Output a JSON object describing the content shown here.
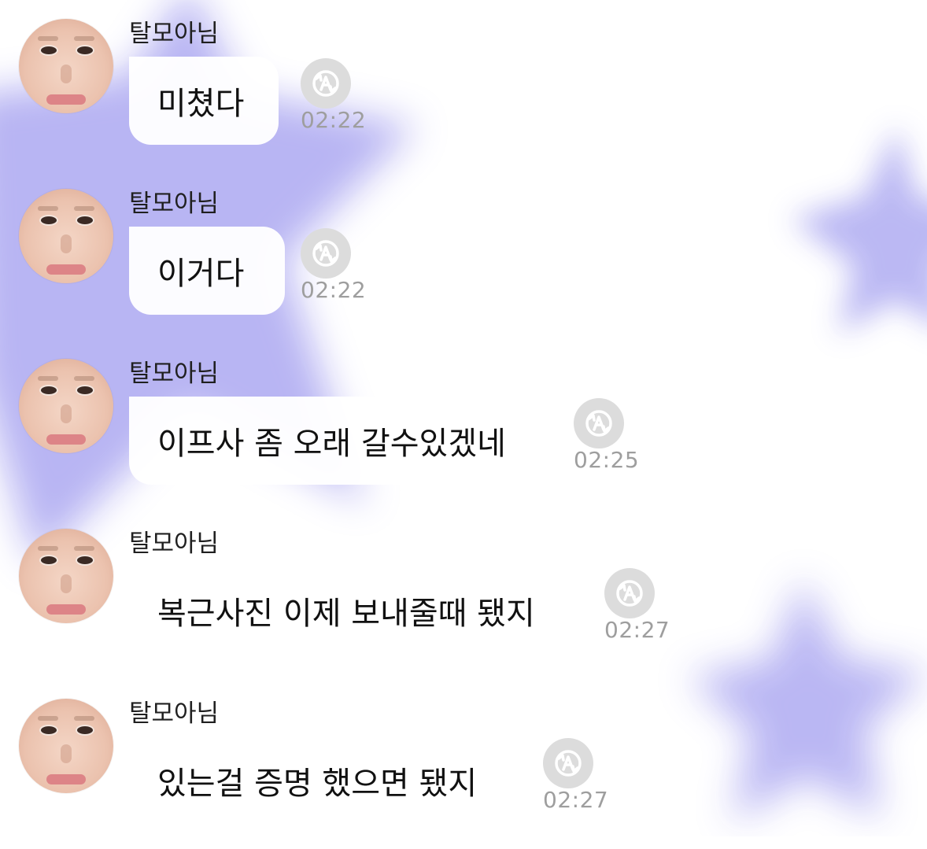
{
  "colors": {
    "star_fill": "#b7b4f3",
    "star_fill_light": "#d8d6fb",
    "bubble_bg": "#ffffff",
    "name_text": "#202020",
    "message_text": "#111111",
    "time_text": "#9e9e9e",
    "icon_bg": "#dcdcdc"
  },
  "messages": [
    {
      "sender": "탈모아님",
      "text": "미쳤다",
      "time": "02:22",
      "icon": "translate-icon"
    },
    {
      "sender": "탈모아님",
      "text": "이거다",
      "time": "02:22",
      "icon": "translate-icon"
    },
    {
      "sender": "탈모아님",
      "text": "이프사 좀 오래 갈수있겠네",
      "time": "02:25",
      "icon": "translate-icon"
    },
    {
      "sender": "탈모아님",
      "text": "복근사진 이제 보내줄때 됐지",
      "time": "02:27",
      "icon": "translate-icon"
    },
    {
      "sender": "탈모아님",
      "text": "있는걸 증명 했으면 됐지",
      "time": "02:27",
      "icon": "translate-icon"
    }
  ]
}
